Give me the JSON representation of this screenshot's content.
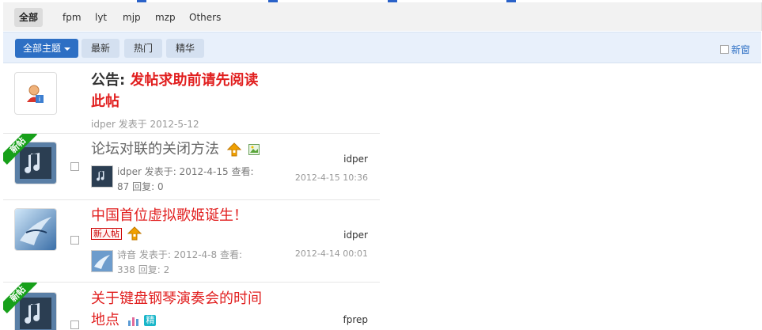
{
  "type_tabs": [
    "全部",
    "fpm",
    "lyt",
    "mjp",
    "mzp",
    "Others"
  ],
  "filters": {
    "all_topics": "全部主题",
    "latest": "最新",
    "hot": "热门",
    "digest": "精华",
    "new_window": "新窗"
  },
  "announcement": {
    "prefix": "公告:",
    "title_line1": "发帖求助前请先阅读",
    "title_line2": "此帖",
    "meta": "idper 发表于 2012-5-12"
  },
  "threads": [
    {
      "ribbon": "新帖",
      "title": "论坛对联的关闭方法",
      "meta_line1": "idper 发表于: 2012-4-15 查看:",
      "meta_line2": "87 回复: 0",
      "last_author": "idper",
      "last_time": "2012-4-15 10:36"
    },
    {
      "title": "中国首位虚拟歌姬诞生！",
      "badge": "新人帖",
      "meta_line1": "诗音 发表于: 2012-4-8 查看:",
      "meta_line2": "338 回复: 2",
      "last_author": "idper",
      "last_time": "2012-4-14 00:01"
    },
    {
      "ribbon": "新帖",
      "title_line1": "关于键盘钢琴演奏会的时间",
      "title_line2": "地点",
      "badge": "精",
      "last_author": "fprep"
    }
  ],
  "colors": {
    "link_red": "#e11f1f",
    "title_gray": "#666666",
    "primary_blue": "#2d6fc4",
    "ribbon_green": "#17a01a"
  }
}
